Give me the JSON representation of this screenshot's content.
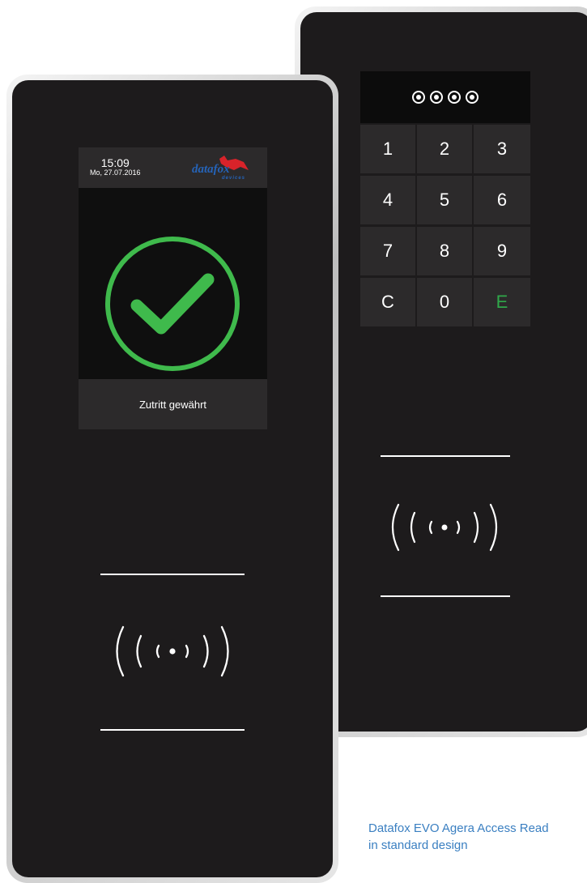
{
  "keypad_reader": {
    "pin_display": {
      "entered_digits": 4
    },
    "keys": [
      "1",
      "2",
      "3",
      "4",
      "5",
      "6",
      "7",
      "8",
      "9",
      "C",
      "0",
      "E"
    ],
    "enter_key_color": "#2fa84a",
    "rfid_icon": "rfid-waves-icon"
  },
  "display_reader": {
    "header": {
      "time": "15:09",
      "date": "Mo, 27.07.2016",
      "logo_text": "datafox",
      "logo_subtext": "devices"
    },
    "status_icon": "check-circle-icon",
    "status_color": "#3fba4c",
    "status_text": "Zutritt gewährt",
    "rfid_icon": "rfid-waves-icon"
  },
  "caption": {
    "line1": "Datafox EVO Agera Access Read",
    "line2": "in standard design"
  },
  "colors": {
    "panel": "#1d1b1c",
    "key": "#2c2a2b",
    "caption": "#3a7fc1"
  }
}
